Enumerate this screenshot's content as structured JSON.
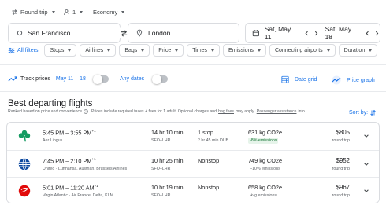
{
  "top_bar": {
    "trip_type": "Round trip",
    "passengers": "1",
    "cabin_class": "Economy"
  },
  "search": {
    "origin": "San Francisco",
    "destination": "London",
    "depart_date": "Sat, May 11",
    "return_date": "Sat, May 18"
  },
  "filters": {
    "all_filters": "All filters",
    "chips": [
      "Stops",
      "Airlines",
      "Bags",
      "Price",
      "Times",
      "Emissions",
      "Connecting airports",
      "Duration"
    ]
  },
  "tracking": {
    "track_prices": "Track prices",
    "date_range": "May 11 – 18",
    "any_dates": "Any dates",
    "date_grid": "Date grid",
    "price_graph": "Price graph"
  },
  "results": {
    "title": "Best departing flights",
    "ranked_text": "Ranked based on price and convenience",
    "prices_text": "Prices include required taxes + fees for 1 adult. Optional charges and",
    "bag_fees": "bag fees",
    "may_apply": "may apply.",
    "passenger_assistance": "Passenger assistance",
    "info_suffix": "info.",
    "sort_by": "Sort by:",
    "flights": [
      {
        "times": "5:45 PM – 3:55 PM",
        "day_offset": "+1",
        "airline": "Aer Lingus",
        "duration": "14 hr 10 min",
        "route": "SFO–LHR",
        "stops": "1 stop",
        "layover": "2 hr 45 min DUB",
        "co2": "631 kg CO2e",
        "emissions": "-8% emissions",
        "price": "$805",
        "price_type": "round trip"
      },
      {
        "times": "7:45 PM – 2:10 PM",
        "day_offset": "+1",
        "airline": "United · Lufthansa, Austrian, Brussels Airlines",
        "duration": "10 hr 25 min",
        "route": "SFO–LHR",
        "stops": "Nonstop",
        "layover": "",
        "co2": "749 kg CO2e",
        "emissions": "+10% emissions",
        "price": "$952",
        "price_type": "round trip"
      },
      {
        "times": "5:01 PM – 11:20 AM",
        "day_offset": "+1",
        "airline": "Virgin Atlantic · Air France, Delta, KLM",
        "duration": "10 hr 19 min",
        "route": "SFO–LHR",
        "stops": "Nonstop",
        "layover": "",
        "co2": "658 kg CO2e",
        "emissions": "Avg emissions",
        "price": "$967",
        "price_type": "round trip"
      }
    ]
  },
  "colors": {
    "accent": "#1a73e8",
    "border": "#dadce0",
    "text": "#202124",
    "muted": "#5f6368",
    "good_emissions_bg": "#e6f4ea",
    "good_emissions_text": "#137333"
  },
  "icons": [
    "swap-arrows-icon",
    "person-icon",
    "location-pin-icon",
    "calendar-icon",
    "chevron-left-icon",
    "chevron-right-icon",
    "filter-icon",
    "trend-icon",
    "grid-icon",
    "graph-icon",
    "info-icon",
    "sort-icon",
    "chevron-down-icon",
    "shamrock-icon",
    "globe-icon",
    "virgin-logo-icon"
  ]
}
